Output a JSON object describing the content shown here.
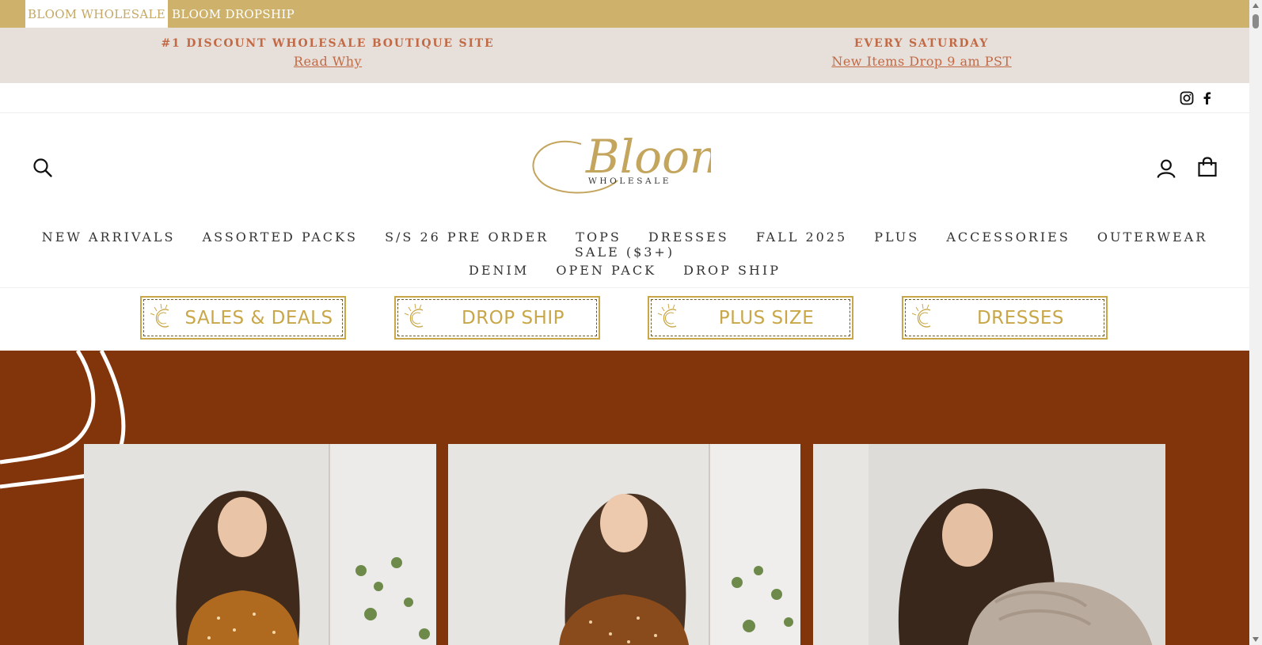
{
  "store_switcher": {
    "active": "BLOOM WHOLESALE",
    "other": "BLOOM DROPSHIP"
  },
  "announcement": {
    "left": {
      "heading": "#1 DISCOUNT WHOLESALE BOUTIQUE SITE",
      "link": "Read Why"
    },
    "right": {
      "heading": "EVERY SATURDAY",
      "link": "New Items Drop 9 am PST"
    }
  },
  "social": {
    "icons": [
      "instagram-icon",
      "facebook-icon"
    ]
  },
  "header": {
    "logo": {
      "script": "Bloom",
      "sub": "WHOLESALE"
    },
    "icons": [
      "search-icon",
      "account-icon",
      "cart-icon"
    ]
  },
  "nav": {
    "row1": [
      "NEW ARRIVALS",
      "ASSORTED PACKS",
      "S/S 26 PRE ORDER",
      "TOPS",
      "DRESSES",
      "FALL 2025",
      "PLUS",
      "ACCESSORIES",
      "OUTERWEAR",
      "SALE ($3+)"
    ],
    "row2": [
      "DENIM",
      "OPEN PACK",
      "DROP SHIP"
    ]
  },
  "categories": [
    "SALES & DEALS",
    "DROP SHIP",
    "PLUS SIZE",
    "DRESSES"
  ],
  "colors": {
    "gold": "#ceb26c",
    "announce_bg": "#e7dfd9",
    "accent": "#c26a45",
    "hero_bg": "#82340a",
    "banner_gold": "#c9a748"
  }
}
